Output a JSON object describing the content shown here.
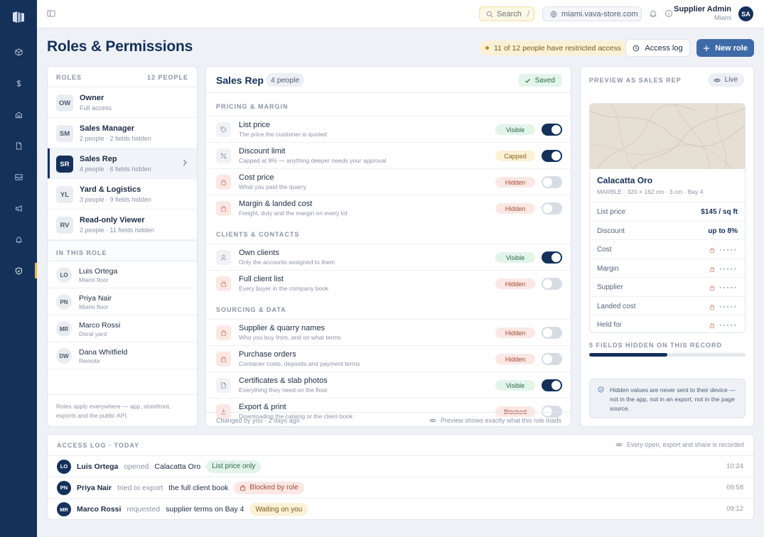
{
  "topbar": {
    "search_label": "Search",
    "search_shortcut": "/",
    "host": "miami.vava-store.com",
    "user_name": "Supplier Admin",
    "user_city": "Miami",
    "user_initials": "SA"
  },
  "header": {
    "title": "Roles & Permissions",
    "restricted_badge": "11 of 12 people have restricted access",
    "access_log_label": "Access log",
    "new_role_label": "New role"
  },
  "roles": {
    "heading": "ROLES",
    "people_count": "12 PEOPLE",
    "items": [
      {
        "abbr": "OW",
        "name": "Owner",
        "sub": "Full access"
      },
      {
        "abbr": "SM",
        "name": "Sales Manager",
        "sub": "2 people · 2 fields hidden"
      },
      {
        "abbr": "SR",
        "name": "Sales Rep",
        "sub": "4 people · 6 fields hidden"
      },
      {
        "abbr": "YL",
        "name": "Yard & Logistics",
        "sub": "3 people · 9 fields hidden"
      },
      {
        "abbr": "RV",
        "name": "Read-only Viewer",
        "sub": "2 people · 11 fields hidden"
      }
    ],
    "in_role_heading": "IN THIS ROLE",
    "people": [
      {
        "initials": "LO",
        "name": "Luis Ortega",
        "sub": "Miami floor"
      },
      {
        "initials": "PN",
        "name": "Priya Nair",
        "sub": "Miami floor"
      },
      {
        "initials": "MR",
        "name": "Marco Rossi",
        "sub": "Doral yard"
      },
      {
        "initials": "DW",
        "name": "Dana Whitfield",
        "sub": "Remote"
      }
    ],
    "footer": "Roles apply everywhere — app, storefront, exports and the public API."
  },
  "permissions": {
    "title": "Sales Rep",
    "count": "4 people",
    "saved": "Saved",
    "groups": [
      {
        "label": "PRICING & MARGIN",
        "rows": [
          {
            "icon": "tag-icon",
            "title": "List price",
            "desc": "The price the customer is quoted",
            "status": "Visible",
            "on": true
          },
          {
            "icon": "percent-icon",
            "title": "Discount limit",
            "desc": "Capped at 8% — anything deeper needs your approval",
            "status": "Capped",
            "on": true
          },
          {
            "icon": "lock-icon",
            "title": "Cost price",
            "desc": "What you paid the quarry",
            "status": "Hidden",
            "on": false
          },
          {
            "icon": "lock-icon",
            "title": "Margin & landed cost",
            "desc": "Freight, duty and the margin on every lot",
            "status": "Hidden",
            "on": false
          }
        ]
      },
      {
        "label": "CLIENTS & CONTACTS",
        "rows": [
          {
            "icon": "user-icon",
            "title": "Own clients",
            "desc": "Only the accounts assigned to them",
            "status": "Visible",
            "on": true
          },
          {
            "icon": "lock-icon",
            "title": "Full client list",
            "desc": "Every buyer in the company book",
            "status": "Hidden",
            "on": false
          }
        ]
      },
      {
        "label": "SOURCING & DATA",
        "rows": [
          {
            "icon": "lock-icon",
            "title": "Supplier & quarry names",
            "desc": "Who you buy from, and on what terms",
            "status": "Hidden",
            "on": false
          },
          {
            "icon": "lock-icon",
            "title": "Purchase orders",
            "desc": "Container costs, deposits and payment terms",
            "status": "Hidden",
            "on": false
          },
          {
            "icon": "document-icon",
            "title": "Certificates & slab photos",
            "desc": "Everything they need on the floor",
            "status": "Visible",
            "on": true
          },
          {
            "icon": "download-icon",
            "title": "Export & print",
            "desc": "Downloading the catalog or the client book",
            "status": "Blocked",
            "on": false
          }
        ]
      }
    ],
    "footer_left": "Changed by you · 2 days ago",
    "footer_right": "Preview shows exactly what this role loads"
  },
  "preview": {
    "heading": "PREVIEW AS SALES REP",
    "live": "Live",
    "slab_name": "Calacatta Oro",
    "slab_sub": "MARBLE · 320 × 162 cm · 3 cm · Bay 4",
    "fields": [
      {
        "label": "List price",
        "value": "$145 / sq ft",
        "masked": false
      },
      {
        "label": "Discount",
        "value": "up to 8%",
        "masked": false
      },
      {
        "label": "Cost",
        "value": "•••••",
        "masked": true
      },
      {
        "label": "Margin",
        "value": "•••••",
        "masked": true
      },
      {
        "label": "Supplier",
        "value": "•••••",
        "masked": true
      },
      {
        "label": "Landed cost",
        "value": "•••••",
        "masked": true
      },
      {
        "label": "Held for",
        "value": "•••••",
        "masked": true
      }
    ],
    "hidden_label": "5 FIELDS HIDDEN ON THIS RECORD",
    "hidden_progress": 0.5,
    "note": "Hidden values are never sent to their device — not in the app, not in an export, not in the page source."
  },
  "access_log": {
    "heading": "ACCESS LOG · TODAY",
    "right_note": "Every open, export and share is recorded",
    "entries": [
      {
        "initials": "LO",
        "name": "Luis Ortega",
        "verb": "opened",
        "object": "Calacatta Oro",
        "badge": "List price only",
        "badge_kind": "green",
        "time": "10:24"
      },
      {
        "initials": "PN",
        "name": "Priya Nair",
        "verb": "tried to export",
        "object": "the full client book",
        "badge": "Blocked by role",
        "badge_kind": "red",
        "time": "09:58"
      },
      {
        "initials": "MR",
        "name": "Marco Rossi",
        "verb": "requested",
        "object": "supplier terms on Bay 4",
        "badge": "Waiting on you",
        "badge_kind": "amber",
        "time": "09:12"
      }
    ]
  },
  "colors": {
    "navy": "#14315a",
    "accent_blue": "#3f6aa8",
    "active_marker": "#e9b84a",
    "visible_green": "#2d6a46",
    "hidden_red": "#a44a35",
    "capped_amber": "#8a6118"
  }
}
